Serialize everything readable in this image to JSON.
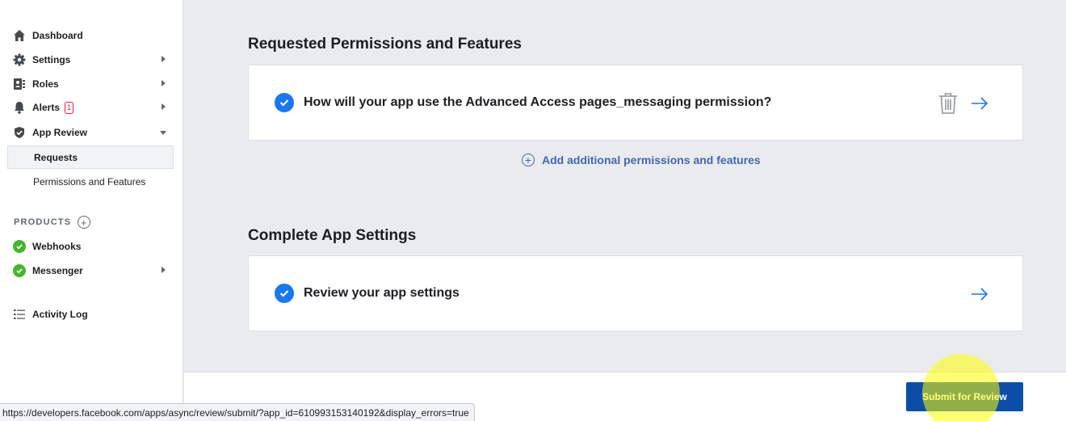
{
  "sidebar": {
    "items": [
      {
        "label": "Dashboard",
        "icon": "home-icon"
      },
      {
        "label": "Settings",
        "icon": "gear-icon"
      },
      {
        "label": "Roles",
        "icon": "roles-icon"
      },
      {
        "label": "Alerts",
        "icon": "bell-icon",
        "badge": "1"
      },
      {
        "label": "App Review",
        "icon": "shield-icon"
      }
    ],
    "app_review_sub": [
      {
        "label": "Requests"
      },
      {
        "label": "Permissions and Features"
      }
    ],
    "products_label": "PRODUCTS",
    "products": [
      {
        "label": "Webhooks"
      },
      {
        "label": "Messenger"
      }
    ],
    "activity_log": "Activity Log"
  },
  "main": {
    "permissions_title": "Requested Permissions and Features",
    "permission_card_text": "How will your app use the Advanced Access pages_messaging permission?",
    "add_link": "Add additional permissions and features",
    "settings_title": "Complete App Settings",
    "settings_card_text": "Review your app settings"
  },
  "footer": {
    "submit_label": "Submit for Review"
  },
  "status_bar": {
    "url": "https://developers.facebook.com/apps/async/review/submit/?app_id=610993153140192&display_errors=true"
  },
  "colors": {
    "accent": "#1877f2",
    "link": "#4267b2",
    "submit": "#0b4ea7",
    "success": "#42b72a",
    "alert": "#e41e3f"
  }
}
